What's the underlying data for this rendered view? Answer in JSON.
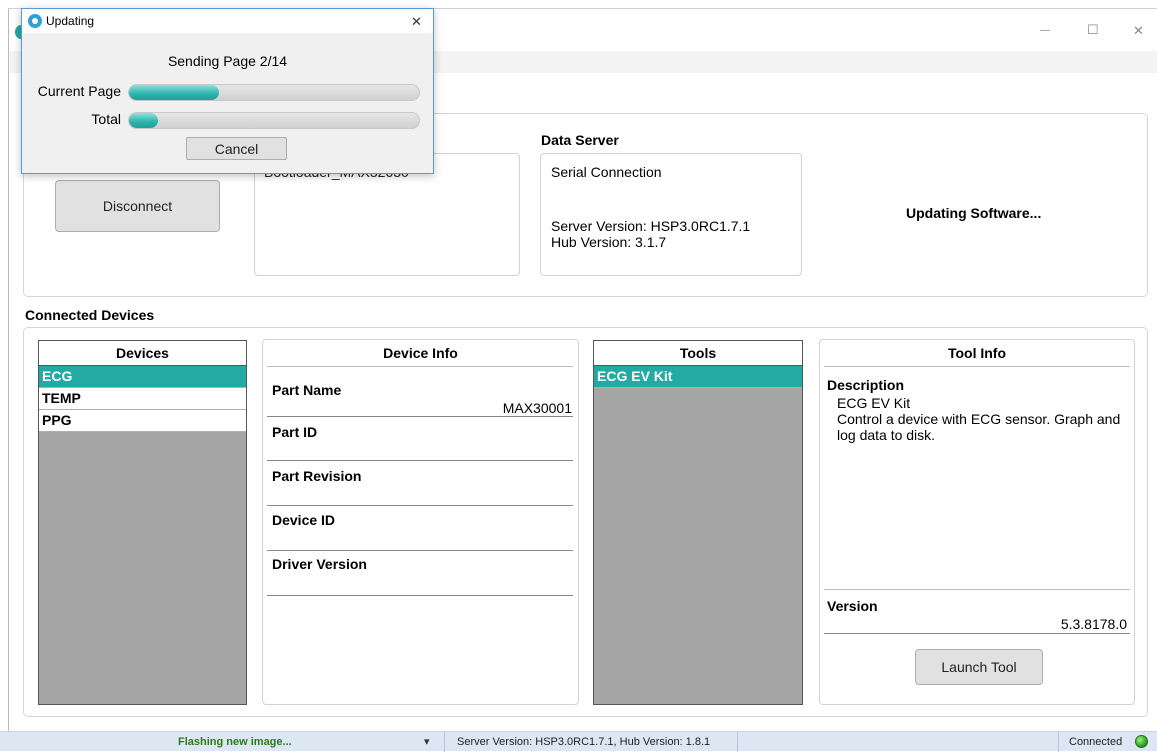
{
  "dialog": {
    "title": "Updating",
    "status": "Sending Page 2/14",
    "current_page_label": "Current Page",
    "current_page_progress": 0.31,
    "total_label": "Total",
    "total_progress": 0.1,
    "cancel_label": "Cancel"
  },
  "window": {
    "controls": {
      "minimize": "—",
      "maximize": "☐",
      "close": "✕"
    }
  },
  "connection": {
    "disconnect_label": "Disconnect",
    "device_box_text": "Bootloader_MAX32630",
    "data_server_title": "Data Server",
    "serial_connection": "Serial Connection",
    "server_version": "Server Version: HSP3.0RC1.7.1",
    "hub_version": "Hub Version: 3.1.7",
    "updating_text": "Updating Software..."
  },
  "connected_devices": {
    "title": "Connected Devices",
    "devices_header": "Devices",
    "devices": [
      "ECG",
      "TEMP",
      "PPG"
    ],
    "selected_device": "ECG",
    "device_info_header": "Device Info",
    "part_name_label": "Part Name",
    "part_name_value": "MAX30001",
    "part_id_label": "Part ID",
    "part_revision_label": "Part Revision",
    "device_id_label": "Device ID",
    "driver_version_label": "Driver Version",
    "tools_header": "Tools",
    "tools": [
      "ECG EV Kit"
    ],
    "tool_info_header": "Tool Info",
    "description_label": "Description",
    "description_title": "ECG EV Kit",
    "description_text": "Control a device with ECG sensor. Graph and log data to disk.",
    "version_label": "Version",
    "version_value": "5.3.8178.0",
    "launch_label": "Launch Tool"
  },
  "statusbar": {
    "message": "Flashing new image...",
    "dropdown_icon": "▾",
    "versions": "Server Version: HSP3.0RC1.7.1, Hub Version: 1.8.1",
    "connection_status": "Connected",
    "status_color": "#2fa61c"
  },
  "colors": {
    "accent": "#24aaa4",
    "selection": "#24aaa4"
  }
}
